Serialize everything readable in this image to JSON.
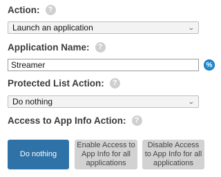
{
  "action": {
    "label": "Action:",
    "help_icon": "?",
    "selected": "Launch an application"
  },
  "app_name": {
    "label": "Application Name:",
    "help_icon": "?",
    "value": "Streamer",
    "variable_icon": "%"
  },
  "protected_list": {
    "label": "Protected List Action:",
    "help_icon": "?",
    "selected": "Do nothing"
  },
  "app_info": {
    "label": "Access to App Info Action:",
    "help_icon": "?",
    "buttons": [
      {
        "label": "Do nothing",
        "state": "selected"
      },
      {
        "label": "Enable Access to App Info for all applications",
        "state": "unselected"
      },
      {
        "label": "Disable Access to App Info for all applications",
        "state": "unselected"
      }
    ]
  },
  "colors": {
    "primary_button": "#2f72a8",
    "secondary_button": "#d2d2d2",
    "variable_icon": "#1f8bd0"
  }
}
